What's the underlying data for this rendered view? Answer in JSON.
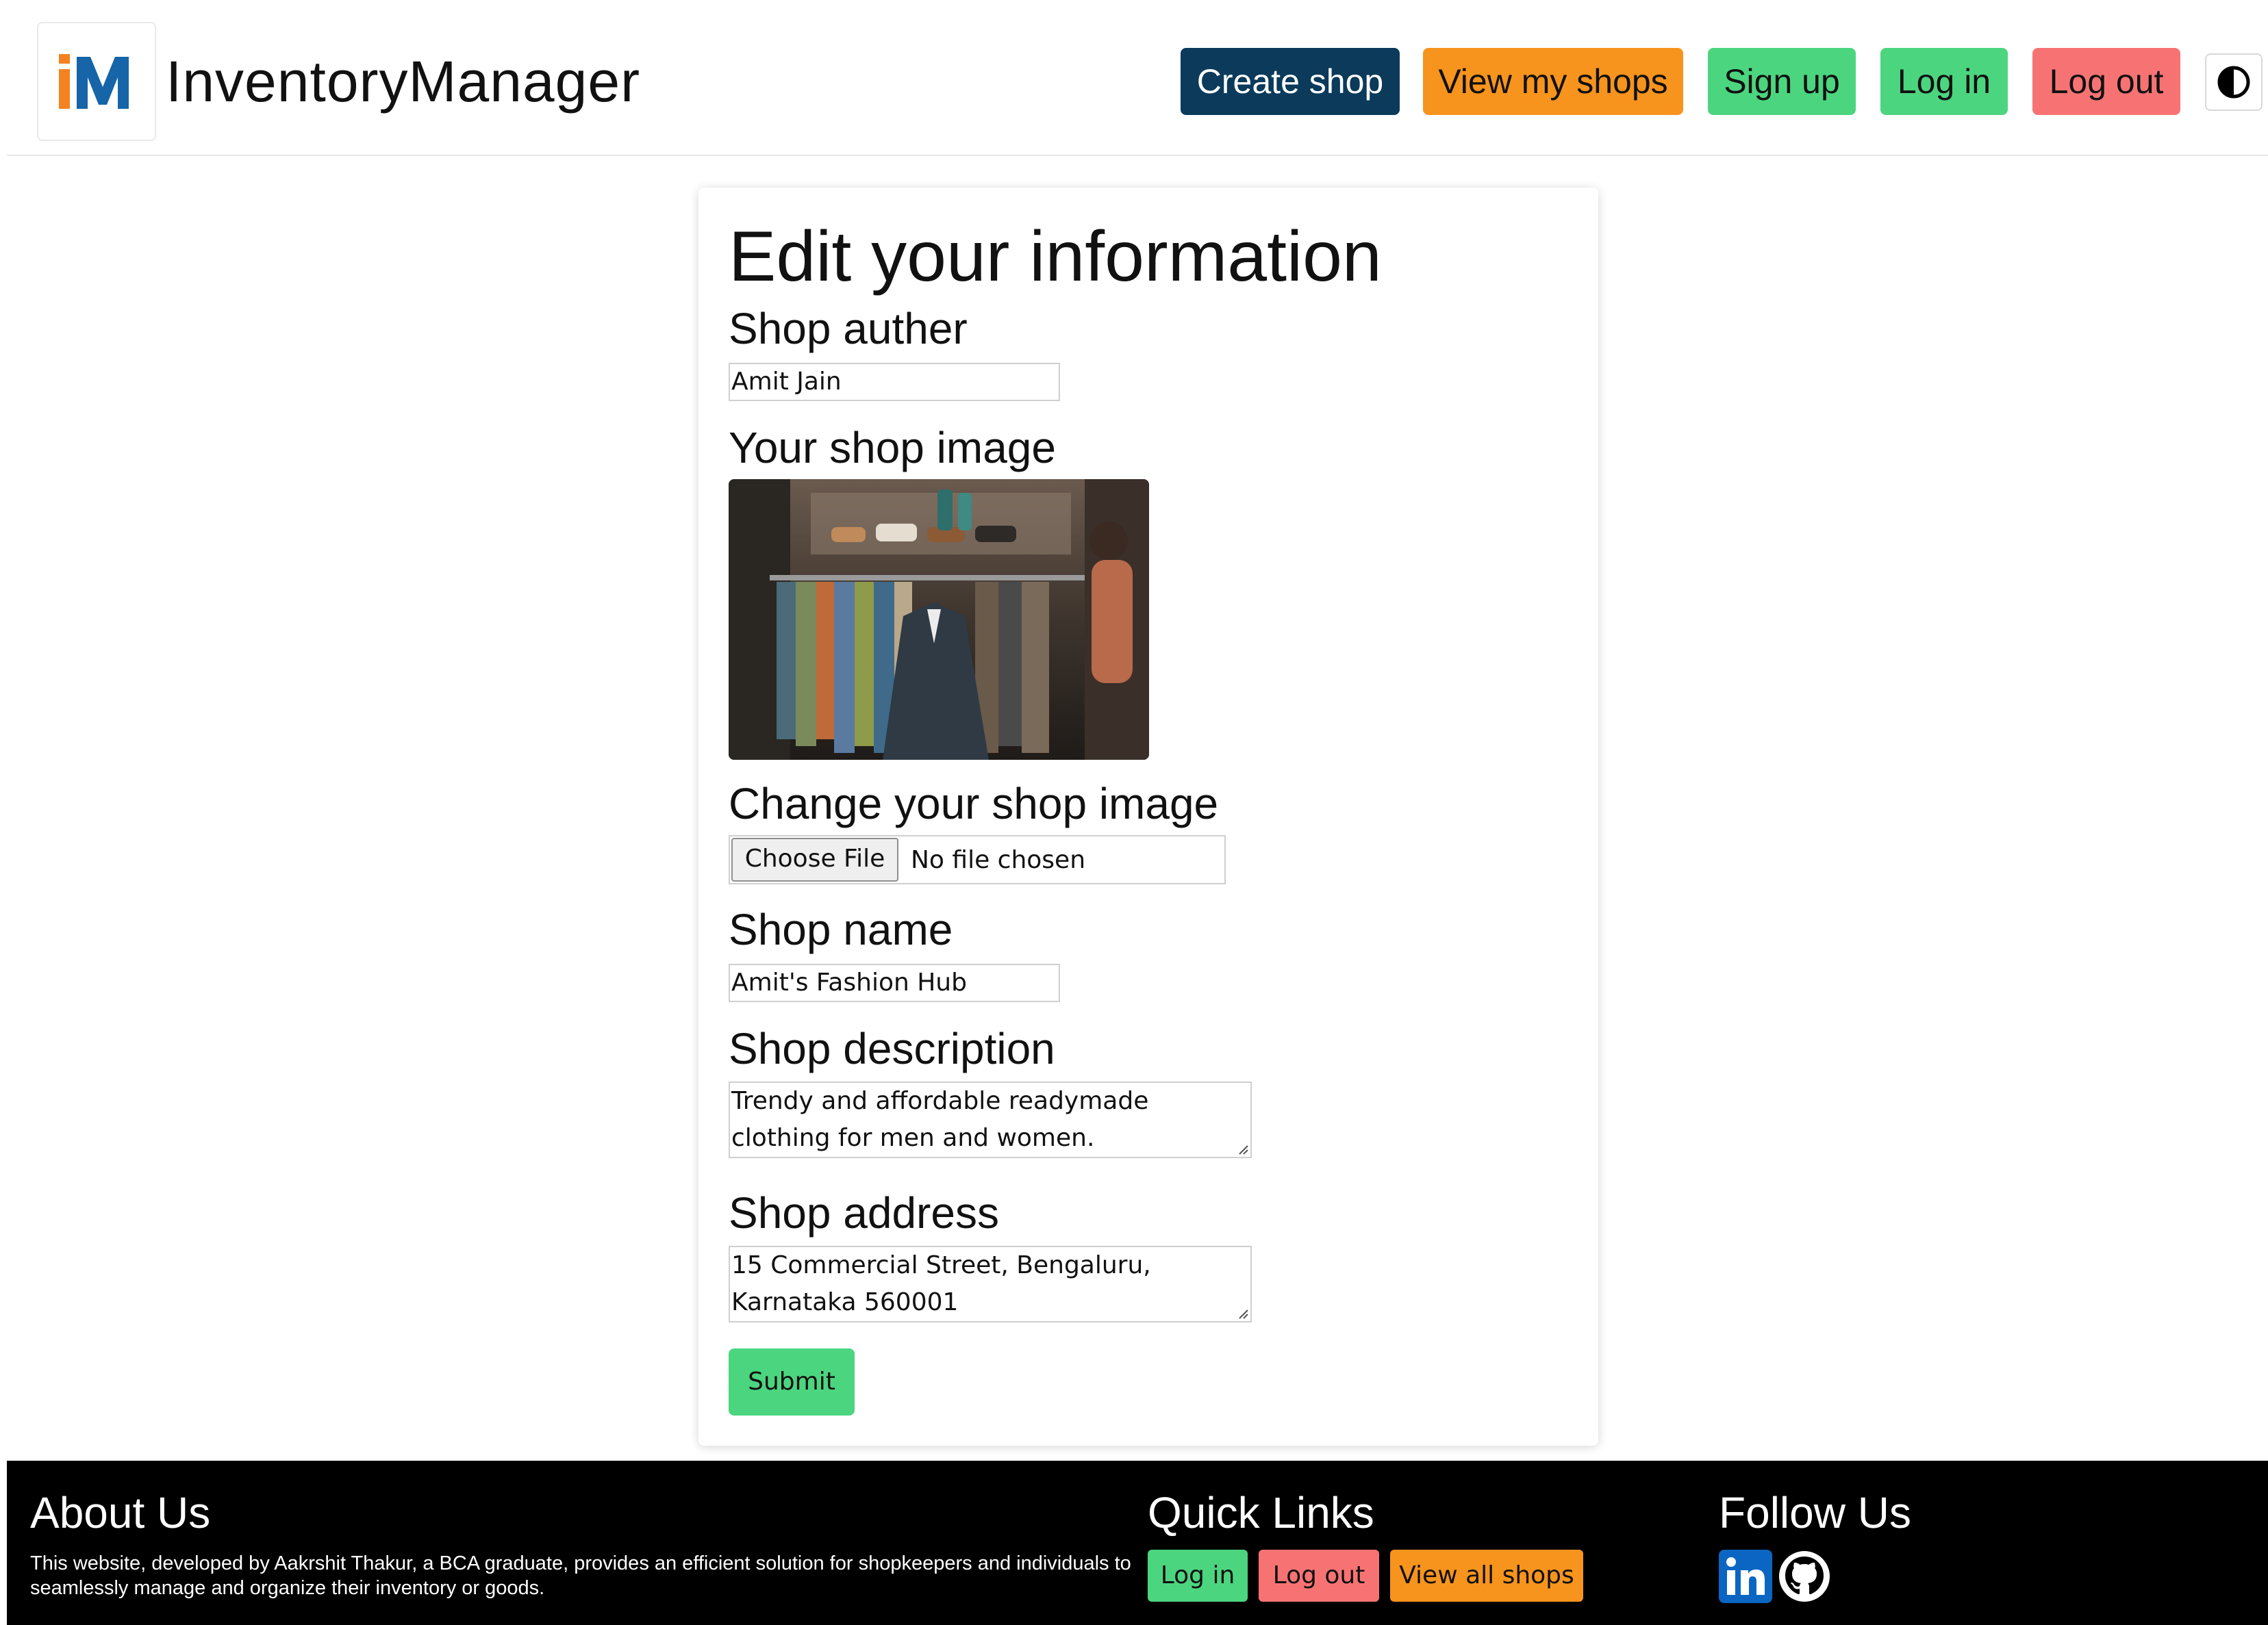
{
  "header": {
    "brand": "InventoryManager",
    "logo_letters": "iM",
    "nav": {
      "create_shop": "Create shop",
      "view_my_shops": "View my shops",
      "sign_up": "Sign up",
      "log_in": "Log in",
      "log_out": "Log out"
    },
    "theme_toggle_icon": "contrast-icon"
  },
  "form": {
    "title": "Edit your information",
    "author_label": "Shop auther",
    "author_value": "Amit Jain",
    "image_label": "Your shop image",
    "change_image_label": "Change your shop image",
    "file_button": "Choose File",
    "file_status": "No file chosen",
    "name_label": "Shop name",
    "name_value": "Amit's Fashion Hub",
    "description_label": "Shop description",
    "description_value": "Trendy and affordable readymade clothing for men and women.",
    "address_label": "Shop address",
    "address_value": "15 Commercial Street, Bengaluru, Karnataka 560001",
    "submit": "Submit"
  },
  "footer": {
    "about_heading": "About Us",
    "about_text": "This website, developed by Aakrshit Thakur, a BCA graduate, provides an efficient solution for shopkeepers and individuals to seamlessly manage and organize their inventory or goods.",
    "links_heading": "Quick Links",
    "links": {
      "log_in": "Log in",
      "log_out": "Log out",
      "view_all_shops": "View all shops"
    },
    "follow_heading": "Follow Us",
    "social_icons": [
      "linkedin-icon",
      "github-icon"
    ]
  },
  "colors": {
    "navy": "#0b3a5b",
    "orange": "#f7941d",
    "green": "#4cd57f",
    "red": "#f77373",
    "logo_orange": "#f58220",
    "logo_blue": "#1565a8"
  }
}
